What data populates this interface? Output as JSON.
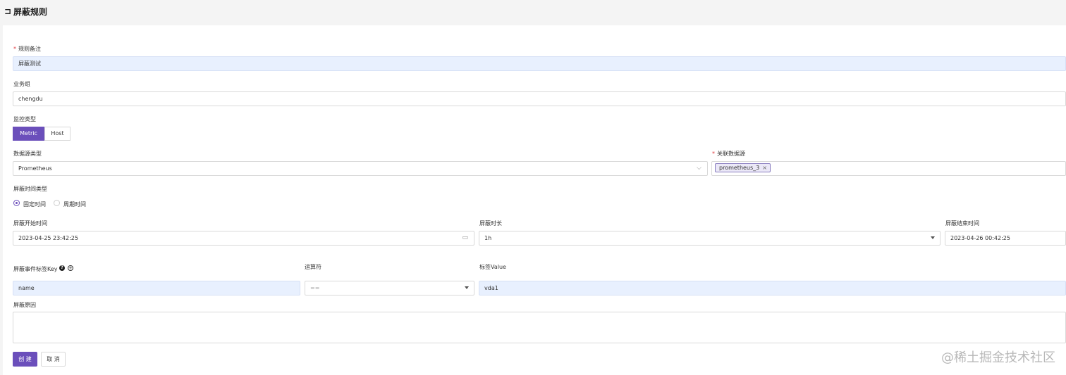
{
  "header": {
    "back_icon": "return-icon",
    "title": "屏蔽规则"
  },
  "form": {
    "rule_note": {
      "label": "规则备注",
      "value": "屏蔽测试"
    },
    "business_group": {
      "label": "业务组",
      "value": "chengdu"
    },
    "monitor_type": {
      "label": "监控类型",
      "options": [
        "Metric",
        "Host"
      ],
      "selected": "Metric"
    },
    "datasource_type": {
      "label": "数据源类型",
      "value": "Prometheus"
    },
    "datasource": {
      "label": "关联数据源",
      "tags": [
        "prometheus_3"
      ]
    },
    "time_type": {
      "label": "屏蔽时间类型",
      "options": [
        "固定时间",
        "周期时间"
      ],
      "selected": "固定时间"
    },
    "start_time": {
      "label": "屏蔽开始时间",
      "value": "2023-04-25 23:42:25",
      "icon": "calendar-icon"
    },
    "duration": {
      "label": "屏蔽时长",
      "value": "1h"
    },
    "end_time": {
      "label": "屏蔽结束时间",
      "value": "2023-04-26 00:42:25"
    },
    "tag_key": {
      "label": "屏蔽事件标签Key",
      "value": "name",
      "help_icon": "question-circle-icon",
      "add_icon": "plus-circle-icon"
    },
    "operator": {
      "label": "运算符",
      "value": "=="
    },
    "tag_value": {
      "label": "标签Value",
      "value": "vda1"
    },
    "reason": {
      "label": "屏蔽原因",
      "value": ""
    },
    "create_button": "创 建",
    "cancel_button": "取 消"
  },
  "watermark": "@稀土掘金技术社区",
  "colors": {
    "primary": "#6b4fbb",
    "filled_input": "#e8f0fe",
    "required": "#e0393e"
  }
}
